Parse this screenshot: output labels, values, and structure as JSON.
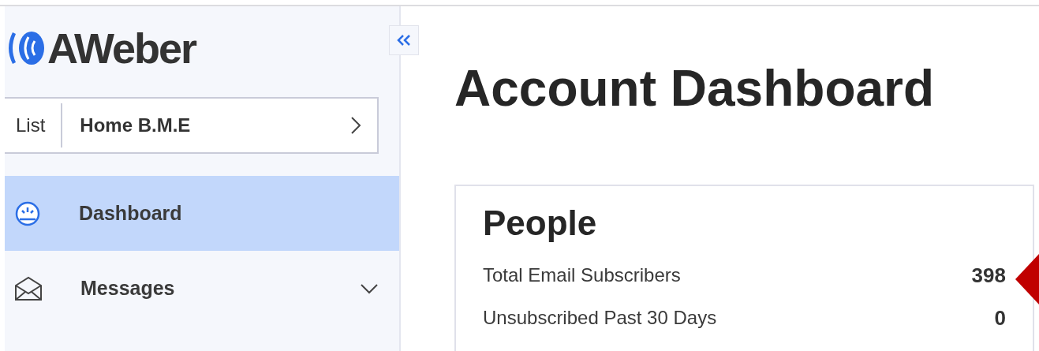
{
  "sidebar": {
    "logo": "AWeber",
    "list_selector": {
      "label": "List",
      "value": "Home B.M.E"
    },
    "items": [
      {
        "label": "Dashboard",
        "selected": true,
        "kind": "dashboard",
        "expandable": false
      },
      {
        "label": "Messages",
        "selected": false,
        "kind": "messages",
        "expandable": true
      }
    ]
  },
  "main": {
    "title": "Account Dashboard",
    "card": {
      "title": "People",
      "rows": [
        {
          "label": "Total Email Subscribers",
          "value": "398",
          "highlighted": true
        },
        {
          "label": "Unsubscribed Past 30 Days",
          "value": "0",
          "highlighted": false
        }
      ]
    }
  }
}
